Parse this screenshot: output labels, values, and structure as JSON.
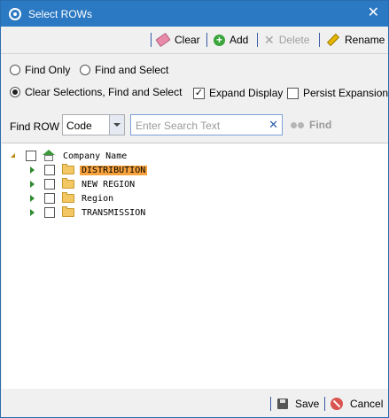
{
  "window": {
    "title": "Select ROWs"
  },
  "toolbar": {
    "clear_label": "Clear",
    "add_label": "Add",
    "delete_label": "Delete",
    "rename_label": "Rename"
  },
  "options": {
    "find_only": {
      "label": "Find Only",
      "checked": false
    },
    "find_and_select": {
      "label": "Find and Select",
      "checked": false
    },
    "clear_find_select": {
      "label": "Clear Selections, Find and Select",
      "checked": true
    },
    "expand_display": {
      "label": "Expand Display",
      "checked": true
    },
    "persist_expansion": {
      "label": "Persist Expansion",
      "checked": false
    }
  },
  "find": {
    "label": "Find ROW",
    "field_value": "Code",
    "search_placeholder": "Enter Search Text",
    "find_label": "Find"
  },
  "tree": {
    "root": {
      "label": "Company Name"
    },
    "children": [
      {
        "label": "DISTRIBUTION",
        "selected": true
      },
      {
        "label": "NEW REGION",
        "selected": false
      },
      {
        "label": "Region",
        "selected": false
      },
      {
        "label": "TRANSMISSION",
        "selected": false
      }
    ]
  },
  "footer": {
    "save_label": "Save",
    "cancel_label": "Cancel"
  }
}
